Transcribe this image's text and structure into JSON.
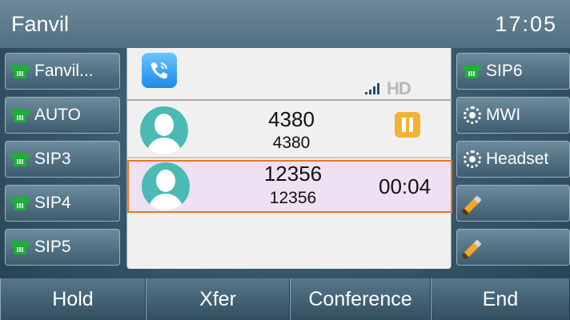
{
  "status_bar": {
    "brand": "Fanvil",
    "time": "17:05"
  },
  "left_keys": [
    {
      "label": "Fanvil...",
      "icon": "phone-icon"
    },
    {
      "label": "AUTO",
      "icon": "phone-icon"
    },
    {
      "label": "SIP3",
      "icon": "phone-icon"
    },
    {
      "label": "SIP4",
      "icon": "phone-icon"
    },
    {
      "label": "SIP5",
      "icon": "phone-icon"
    }
  ],
  "right_keys": [
    {
      "label": "SIP6",
      "icon": "phone-icon"
    },
    {
      "label": "MWI",
      "icon": "mwi-icon"
    },
    {
      "label": "Headset",
      "icon": "mwi-icon"
    },
    {
      "label": "",
      "icon": "pencil-icon"
    },
    {
      "label": "",
      "icon": "pencil-icon"
    }
  ],
  "call_panel": {
    "quality": "HD",
    "calls": [
      {
        "name": "4380",
        "number": "4380",
        "state": "held"
      },
      {
        "name": "12356",
        "number": "12356",
        "duration": "00:04",
        "state": "active"
      }
    ]
  },
  "softkeys": [
    "Hold",
    "Xfer",
    "Conference",
    "End"
  ],
  "colors": {
    "accent": "#e8761c",
    "line_icon": "#1fae3a",
    "active_call_bg": "#efe0f3",
    "hold_icon": "#f2b234"
  }
}
